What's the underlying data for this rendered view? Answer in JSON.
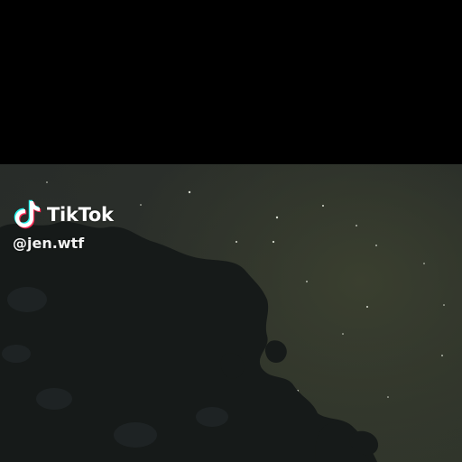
{
  "watermark": {
    "brand": "TikTok",
    "username": "@jen.wtf",
    "logo_icon": "tiktok-note-icon"
  },
  "scene": {
    "type": "night-sky-with-tree-silhouette"
  },
  "colors": {
    "background": "#000000",
    "sky": "#2b2f2a",
    "sky_glow": "#3a3f2f",
    "tree": "#161a19",
    "text": "#ffffff",
    "logo_cyan": "#25f4ee",
    "logo_red": "#fe2c55"
  }
}
